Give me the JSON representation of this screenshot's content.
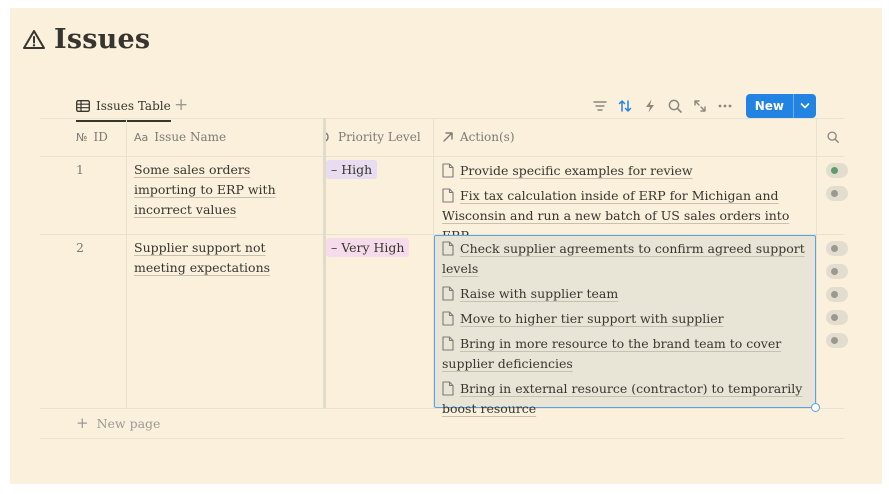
{
  "page": {
    "title": "Issues",
    "title_icon": "warning-icon"
  },
  "view": {
    "tab_label": "Issues Table",
    "new_button_label": "New",
    "tools": [
      "filter-icon",
      "sort-icon",
      "automation-icon",
      "search-icon",
      "expand-icon",
      "more-icon"
    ]
  },
  "columns": {
    "id": "ID",
    "name": "Issue Name",
    "priority": "Priority Level",
    "actions": "Action(s)"
  },
  "rows": [
    {
      "id": "1",
      "name": "Some sales orders importing to ERP with incorrect values",
      "priority": "High",
      "actions": [
        "Provide specific examples for review",
        "Fix tax calculation inside of ERP for Michigan and Wisconsin and run a new batch of US sales orders into ERP"
      ]
    },
    {
      "id": "2",
      "name": "Supplier support not meeting expectations",
      "priority": "Very High",
      "actions": [
        "Check supplier agreements to confirm agreed support levels",
        "Raise with supplier team",
        "Move to higher tier support with supplier",
        "Bring in more resource to the brand team to cover supplier deficiencies",
        "Bring in external resource (contractor) to temporarily boost resource"
      ]
    }
  ],
  "footer": {
    "new_page_label": "New page"
  },
  "colors": {
    "accent": "#2383e2",
    "page_bg": "#faf0dc",
    "high_tag": "#e8dcf0",
    "very_high_tag": "#f6dcea"
  }
}
